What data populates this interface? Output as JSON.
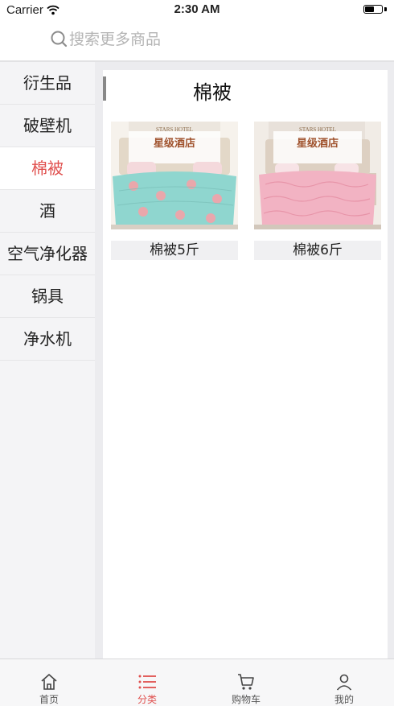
{
  "status_bar": {
    "carrier": "Carrier",
    "time": "2:30 AM"
  },
  "search": {
    "placeholder": "搜索更多商品"
  },
  "sidebar": {
    "items": [
      {
        "label": "衍生品"
      },
      {
        "label": "破壁机"
      },
      {
        "label": "棉被",
        "active": true
      },
      {
        "label": "酒"
      },
      {
        "label": "空气净化器"
      },
      {
        "label": "锅具"
      },
      {
        "label": "净水机"
      }
    ]
  },
  "content": {
    "title": "棉被",
    "products": [
      {
        "name": "棉被5斤",
        "image_banner": "STARS HOTEL",
        "image_title": "星级酒店",
        "quilt_color": "#8fd6cf"
      },
      {
        "name": "棉被6斤",
        "image_banner": "STARS HOTEL",
        "image_title": "星级酒店",
        "quilt_color": "#f2b3c3"
      }
    ]
  },
  "tabbar": {
    "tabs": [
      {
        "label": "首页",
        "icon": "home-icon"
      },
      {
        "label": "分类",
        "icon": "list-icon",
        "active": true
      },
      {
        "label": "购物车",
        "icon": "cart-icon"
      },
      {
        "label": "我的",
        "icon": "user-icon"
      }
    ]
  },
  "colors": {
    "accent": "#e0504e",
    "sidebar_bg": "#f4f4f6",
    "placeholder": "#b4b4b4"
  }
}
